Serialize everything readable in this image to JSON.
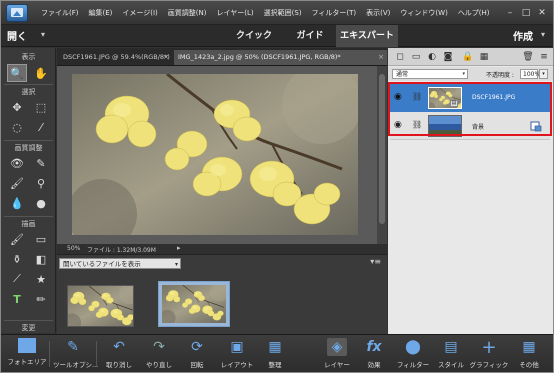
{
  "menubar": {
    "items": [
      "ファイル(F)",
      "編集(E)",
      "イメージ(I)",
      "画質調整(N)",
      "レイヤー(L)",
      "選択範囲(S)",
      "フィルター(T)",
      "表示(V)",
      "ウィンドウ(W)",
      "ヘルプ(H)"
    ],
    "window_controls": [
      "–",
      "□",
      "✕"
    ]
  },
  "modebar": {
    "open_label": "開く",
    "tabs": [
      "クイック",
      "ガイド",
      "エキスパート"
    ],
    "active_tab": "エキスパート",
    "create_label": "作成"
  },
  "toolbox": {
    "sections": [
      "表示",
      "選択",
      "画質調整",
      "描画",
      "変更"
    ]
  },
  "document_tabs": [
    {
      "title": "DSCF1961.JPG @ 59.4%(RGB/8*)",
      "active": false
    },
    {
      "title": "IMG_1423a_2.jpg @ 50% (DSCF1961.JPG, RGB/8)*",
      "active": true
    }
  ],
  "status": {
    "zoom": "50%",
    "file_info": "ファイル : 1.32M/3.09M"
  },
  "photo_bin": {
    "select_value": "開いているファイルを表示"
  },
  "layers_panel": {
    "blend_mode": "通常",
    "opacity_label": "不透明度 :",
    "opacity_value": "100%",
    "layers": [
      {
        "name": "DSCF1961.JPG",
        "selected": true
      },
      {
        "name": "背景",
        "selected": false
      }
    ],
    "highlight_color": "#e0141c"
  },
  "panelbar": {
    "left": [
      {
        "label": "フォトエリア",
        "icon": "photo-bin-icon"
      },
      {
        "label": "ツールオプシ...",
        "icon": "tool-options-icon"
      },
      {
        "label": "取り消し",
        "icon": "undo-icon"
      },
      {
        "label": "やり直し",
        "icon": "redo-icon"
      },
      {
        "label": "回転",
        "icon": "rotate-icon"
      },
      {
        "label": "レイアウト",
        "icon": "layout-icon"
      },
      {
        "label": "整理",
        "icon": "organizer-icon"
      }
    ],
    "right": [
      {
        "label": "レイヤー",
        "icon": "layers-icon"
      },
      {
        "label": "効果",
        "icon": "effects-icon"
      },
      {
        "label": "フィルター",
        "icon": "filters-icon"
      },
      {
        "label": "スタイル",
        "icon": "styles-icon"
      },
      {
        "label": "グラフィック",
        "icon": "graphics-icon"
      },
      {
        "label": "その他",
        "icon": "more-icon"
      }
    ]
  },
  "colors": {
    "accent": "#3b7cc8",
    "highlight": "#e0141c"
  }
}
